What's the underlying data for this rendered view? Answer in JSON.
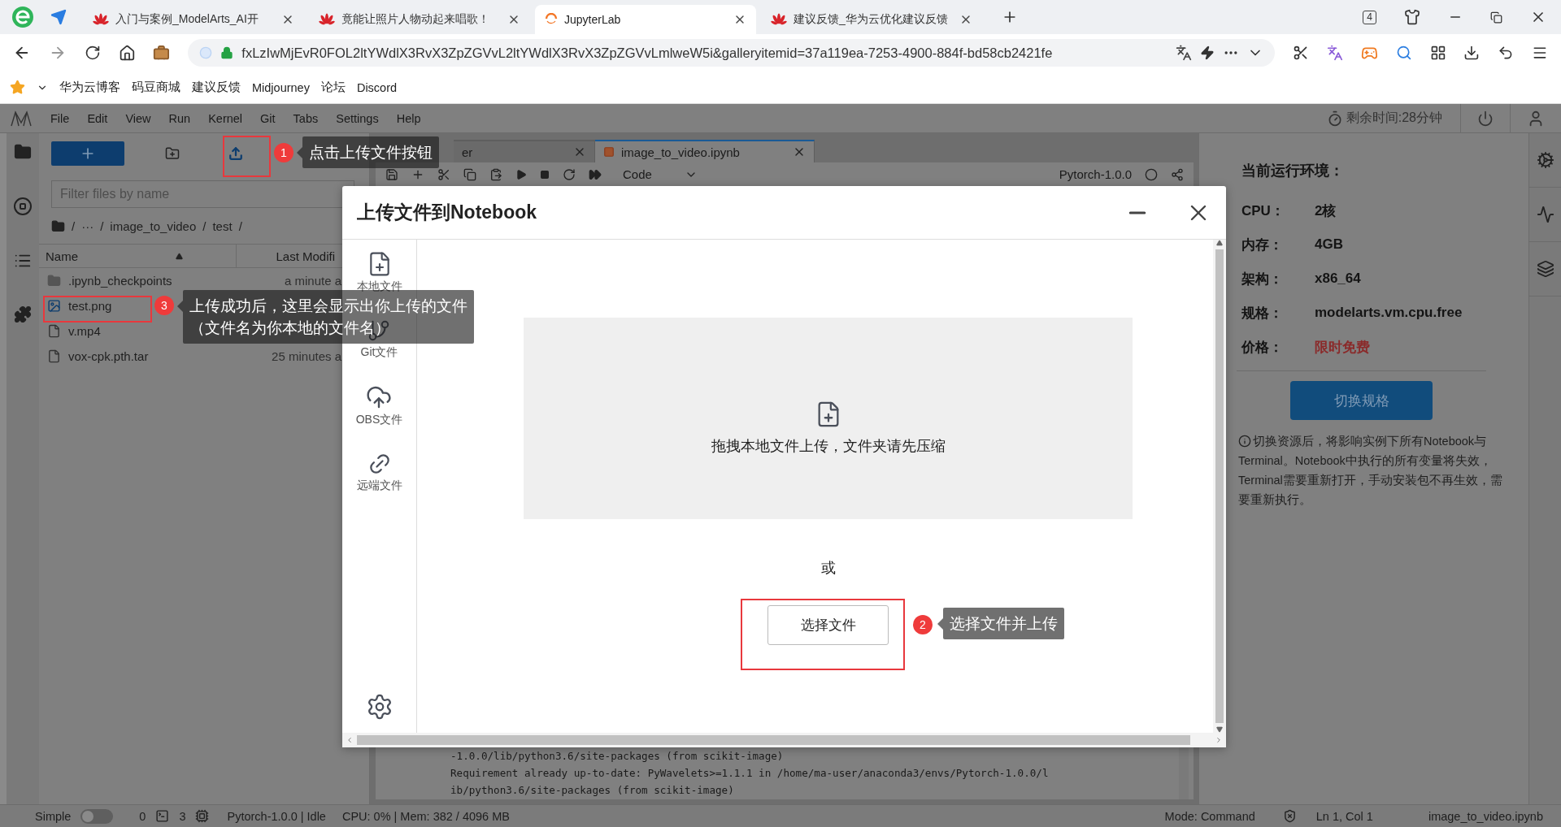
{
  "browser": {
    "tabs": [
      {
        "title": "入门与案例_ModelArts_AI开",
        "selected": false,
        "kind": "huawei"
      },
      {
        "title": "竟能让照片人物动起来唱歌！",
        "selected": false,
        "kind": "huawei"
      },
      {
        "title": "JupyterLab",
        "selected": true,
        "kind": "jupyter"
      },
      {
        "title": "建议反馈_华为云优化建议反馈",
        "selected": false,
        "kind": "huawei"
      }
    ],
    "tab_count": "4",
    "address": "fxLzIwMjEvR0FOL2ltYWdlX3RvX3ZpZGVvL2ltYWdlX3RvX3ZpZGVvLmlweW5i&galleryitemid=37a119ea-7253-4900-884f-bd58cb2421fe",
    "bookmarks": [
      "华为云博客",
      "码豆商城",
      "建议反馈",
      "Midjourney",
      "论坛",
      "Discord"
    ]
  },
  "jupyter": {
    "menu": [
      "File",
      "Edit",
      "View",
      "Run",
      "Kernel",
      "Git",
      "Tabs",
      "Settings",
      "Help"
    ],
    "timer": "剩余时间:28分钟",
    "file_browser": {
      "filter_placeholder": "Filter files by name",
      "path": [
        "/",
        "···",
        "/",
        "image_to_video",
        "/",
        "test",
        "/"
      ],
      "columns": [
        "Name",
        "Last Modifi"
      ],
      "files": [
        {
          "name": ".ipynb_checkpoints",
          "modified": "a minute a",
          "kind": "folder"
        },
        {
          "name": "test.png",
          "kind": "image"
        },
        {
          "name": "v.mp4",
          "kind": "file"
        },
        {
          "name": "vox-cpk.pth.tar",
          "modified": "25 minutes a",
          "kind": "file"
        }
      ]
    },
    "notebook": {
      "tabs": [
        {
          "label": "er",
          "selected": false
        },
        {
          "label": "image_to_video.ipynb",
          "selected": true
        }
      ],
      "cell_type": "Code",
      "kernel": "Pytorch-1.0.0",
      "output": [
        "-1.0.0/lib/python3.6/site-packages (from scikit-image)",
        "Requirement already up-to-date: PyWavelets>=1.1.1 in /home/ma-user/anaconda3/envs/Pytorch-1.0.0/l",
        "ib/python3.6/site-packages (from scikit-image)"
      ]
    }
  },
  "dialog": {
    "title": "上传文件到Notebook",
    "sources": [
      {
        "label": "本地文件",
        "kind": "local"
      },
      {
        "label": "Git文件",
        "kind": "git"
      },
      {
        "label": "OBS文件",
        "kind": "obs"
      },
      {
        "label": "远端文件",
        "kind": "remote"
      }
    ],
    "dropzone_text": "拖拽本地文件上传，文件夹请先压缩",
    "separator": "或",
    "choose_button": "选择文件"
  },
  "environment": {
    "title": "当前运行环境：",
    "specs": [
      {
        "label": "CPU：",
        "value": "2核",
        "highlight": false
      },
      {
        "label": "内存：",
        "value": "4GB",
        "highlight": false
      },
      {
        "label": "架构：",
        "value": "x86_64",
        "highlight": false
      },
      {
        "label": "规格：",
        "value": "modelarts.vm.cpu.free",
        "highlight": false
      },
      {
        "label": "价格：",
        "value": "限时免费",
        "highlight": true
      }
    ],
    "switch_button": "切换规格",
    "note": "切换资源后，将影响实例下所有Notebook与Terminal。Notebook中执行的所有变量将失效，Terminal需要重新打开，手动安装包不再生效，需要重新执行。"
  },
  "status_bar": {
    "mode_label": "Simple",
    "simple_mode": false,
    "terminals": "0",
    "kernels": "3",
    "kernel_status": "Pytorch-1.0.0 | Idle",
    "resources": "CPU: 0% | Mem: 382 / 4096 MB",
    "mode": "Mode: Command",
    "cursor": "Ln 1, Col 1",
    "file": "image_to_video.ipynb"
  },
  "annotations": [
    {
      "number": "1",
      "lines": [
        "点击上传文件按钮"
      ]
    },
    {
      "number": "3",
      "lines": [
        "上传成功后，这里会显示出你上传的文件",
        "（文件名为你本地的文件名）"
      ]
    },
    {
      "number": "2",
      "lines": [
        "选择文件并上传"
      ]
    }
  ]
}
